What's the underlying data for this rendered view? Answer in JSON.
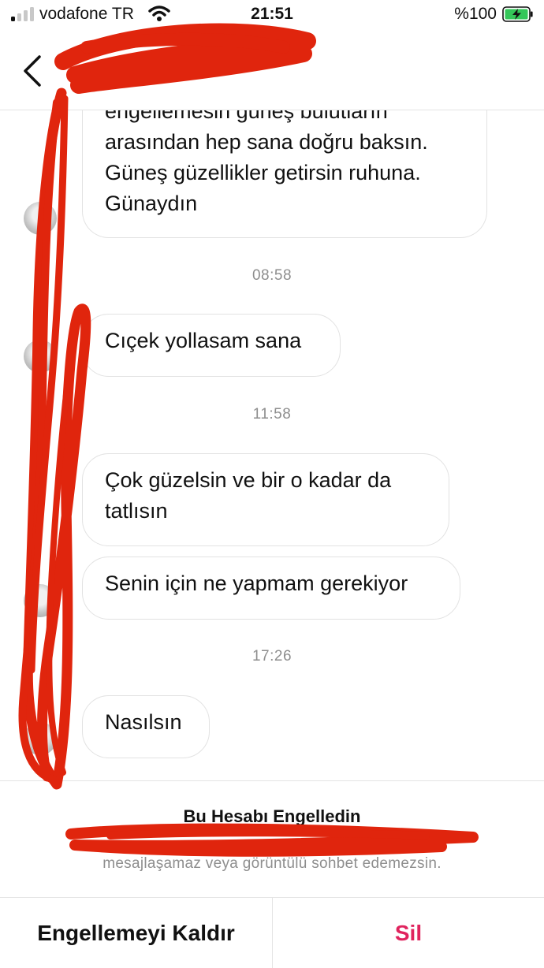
{
  "status_bar": {
    "carrier": "vodafone TR",
    "time": "21:51",
    "battery": "%100"
  },
  "header": {
    "name": ""
  },
  "messages": [
    {
      "text": "engellemesin güneş bulutların\narasından hep sana doğru baksın.\nGüneş güzellikler getirsin ruhuna.\nGünaydın"
    },
    {
      "text": "Cıçek yollasam sana"
    },
    {
      "text": "Çok güzelsin ve bir o kadar da\ntatlısın"
    },
    {
      "text": "Senin için ne yapmam gerekiyor"
    },
    {
      "text": "Nasılsın"
    }
  ],
  "timestamps": [
    "08:58",
    "11:58",
    "17:26"
  ],
  "blocked": {
    "title": "Bu Hesabı Engelledin",
    "description": "mesajlaşamaz veya görüntülü sohbet edemezsin."
  },
  "actions": {
    "unblock_label": "Engellemeyi Kaldır",
    "delete_label": "Sil"
  },
  "colors": {
    "delete": "#e0245e",
    "redaction": "#e0250d",
    "battery": "#34c759"
  }
}
